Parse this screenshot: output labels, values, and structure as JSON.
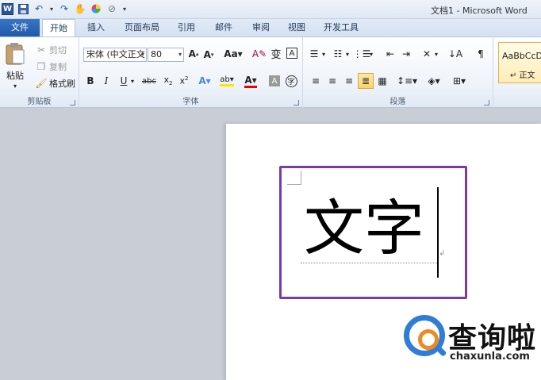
{
  "window": {
    "title": "文档1 - Microsoft Word",
    "icon": "word-logo-icon"
  },
  "qat": {
    "logo_letter": "W"
  },
  "tabs": [
    {
      "label": "文件"
    },
    {
      "label": "开始"
    },
    {
      "label": "插入"
    },
    {
      "label": "页面布局"
    },
    {
      "label": "引用"
    },
    {
      "label": "邮件"
    },
    {
      "label": "审阅"
    },
    {
      "label": "视图"
    },
    {
      "label": "开发工具"
    }
  ],
  "clipboard": {
    "paste_label": "粘贴",
    "cut_label": "剪切",
    "copy_label": "复制",
    "format_painter_label": "格式刷",
    "group_label": "剪贴板"
  },
  "font": {
    "font_name": "宋体 (中文正文",
    "font_size": "80",
    "group_label": "字体"
  },
  "paragraph": {
    "group_label": "段落"
  },
  "styles": {
    "sample": "AaBbCcDc",
    "name": "↵ 正文"
  },
  "document": {
    "text": "文字"
  },
  "watermark": {
    "brand_cn": "查询啦",
    "brand_url": "chaxunla.com"
  },
  "colors": {
    "file_tab": "#1f5aa8",
    "highlight_box": "#7a3aa8",
    "watermark_blue": "#2f7dd6",
    "watermark_orange": "#f08a1e"
  }
}
